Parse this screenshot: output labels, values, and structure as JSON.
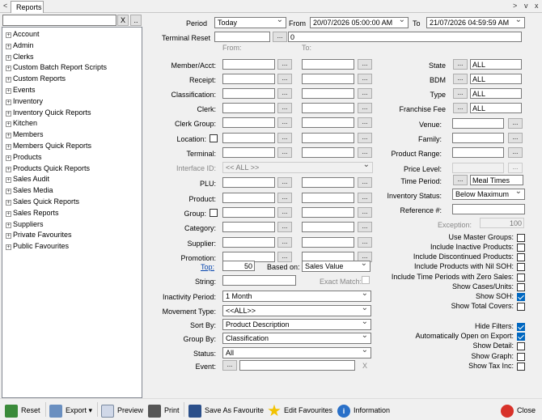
{
  "tabs": {
    "nav_left": "<",
    "title": "Reports",
    "nav_right": ">",
    "nav_down": "v",
    "close": "x"
  },
  "search": {
    "value": "",
    "clear": "X",
    "more": ".."
  },
  "tree": [
    "Account",
    "Admin",
    "Clerks",
    "Custom Batch Report Scripts",
    "Custom Reports",
    "Events",
    "Inventory",
    "Inventory Quick Reports",
    "Kitchen",
    "Members",
    "Members Quick Reports",
    "Products",
    "Products Quick Reports",
    "Sales Audit",
    "Sales Media",
    "Sales Quick Reports",
    "Sales Reports",
    "Suppliers",
    "Private Favourites",
    "Public Favourites"
  ],
  "period": {
    "label": "Period",
    "value": "Today",
    "from_label": "From",
    "from": "20/07/2026 05:00:00 AM",
    "to_label": "To",
    "to": "21/07/2026 04:59:59 AM"
  },
  "terminal_reset": {
    "label": "Terminal Reset",
    "value": "0"
  },
  "col_from": "From:",
  "col_to": "To:",
  "left_rows": [
    "Member/Acct:",
    "Receipt:",
    "Classification:",
    "Clerk:",
    "Clerk Group:",
    "Location:",
    "Terminal:",
    "Interface ID:",
    "PLU:",
    "Product:",
    "Group:",
    "Category:",
    "Supplier:",
    "Promotion:"
  ],
  "interface_value": "<< ALL >>",
  "right_rows": [
    {
      "label": "State",
      "value": "ALL"
    },
    {
      "label": "BDM",
      "value": "ALL"
    },
    {
      "label": "Type",
      "value": "ALL"
    },
    {
      "label": "Franchise Fee",
      "value": "ALL"
    }
  ],
  "right_rows2": [
    "Venue:",
    "Family:",
    "Product Range:",
    "Price Level:"
  ],
  "time_period": {
    "label": "Time Period:",
    "value": "Meal Times"
  },
  "inventory_status": {
    "label": "Inventory Status:",
    "value": "Below Maximum"
  },
  "reference": {
    "label": "Reference #:"
  },
  "exception": {
    "label": "Exception:",
    "value": "100"
  },
  "top": {
    "label": "Top:",
    "value": "50",
    "based_label": "Based on:",
    "based_value": "Sales Value"
  },
  "string": {
    "label": "String:",
    "exact": "Exact Match:"
  },
  "selects": [
    {
      "label": "Inactivity Period:",
      "value": "1 Month"
    },
    {
      "label": "Movement Type:",
      "value": "<<ALL>>"
    },
    {
      "label": "Sort By:",
      "value": "Product Description"
    },
    {
      "label": "Group By:",
      "value": "Classification"
    },
    {
      "label": "Status:",
      "value": "All"
    }
  ],
  "event": {
    "label": "Event:",
    "clear": "X"
  },
  "checks": [
    {
      "label": "Use Master Groups:",
      "on": false
    },
    {
      "label": "Include Inactive Products:",
      "on": false
    },
    {
      "label": "Include Discontinued Products:",
      "on": false
    },
    {
      "label": "Include Products with Nil SOH:",
      "on": false
    },
    {
      "label": "Include Time Periods with Zero Sales:",
      "on": false
    },
    {
      "label": "Show Cases/Units:",
      "on": false
    },
    {
      "label": "Show SOH:",
      "on": true
    },
    {
      "label": "Show Total Covers:",
      "on": false
    }
  ],
  "checks2": [
    {
      "label": "Hide Filters:",
      "on": true
    },
    {
      "label": "Automatically Open on Export:",
      "on": true
    },
    {
      "label": "Show Detail:",
      "on": false
    },
    {
      "label": "Show Graph:",
      "on": false
    },
    {
      "label": "Show Tax Inc:",
      "on": false
    }
  ],
  "toolbar": {
    "reset": "Reset",
    "export": "Export",
    "preview": "Preview",
    "print": "Print",
    "save_fav": "Save As Favourite",
    "edit_fav": "Edit Favourites",
    "info": "Information",
    "close": "Close"
  },
  "colors": {
    "accent": "#0067c0",
    "link": "#0645ad"
  }
}
